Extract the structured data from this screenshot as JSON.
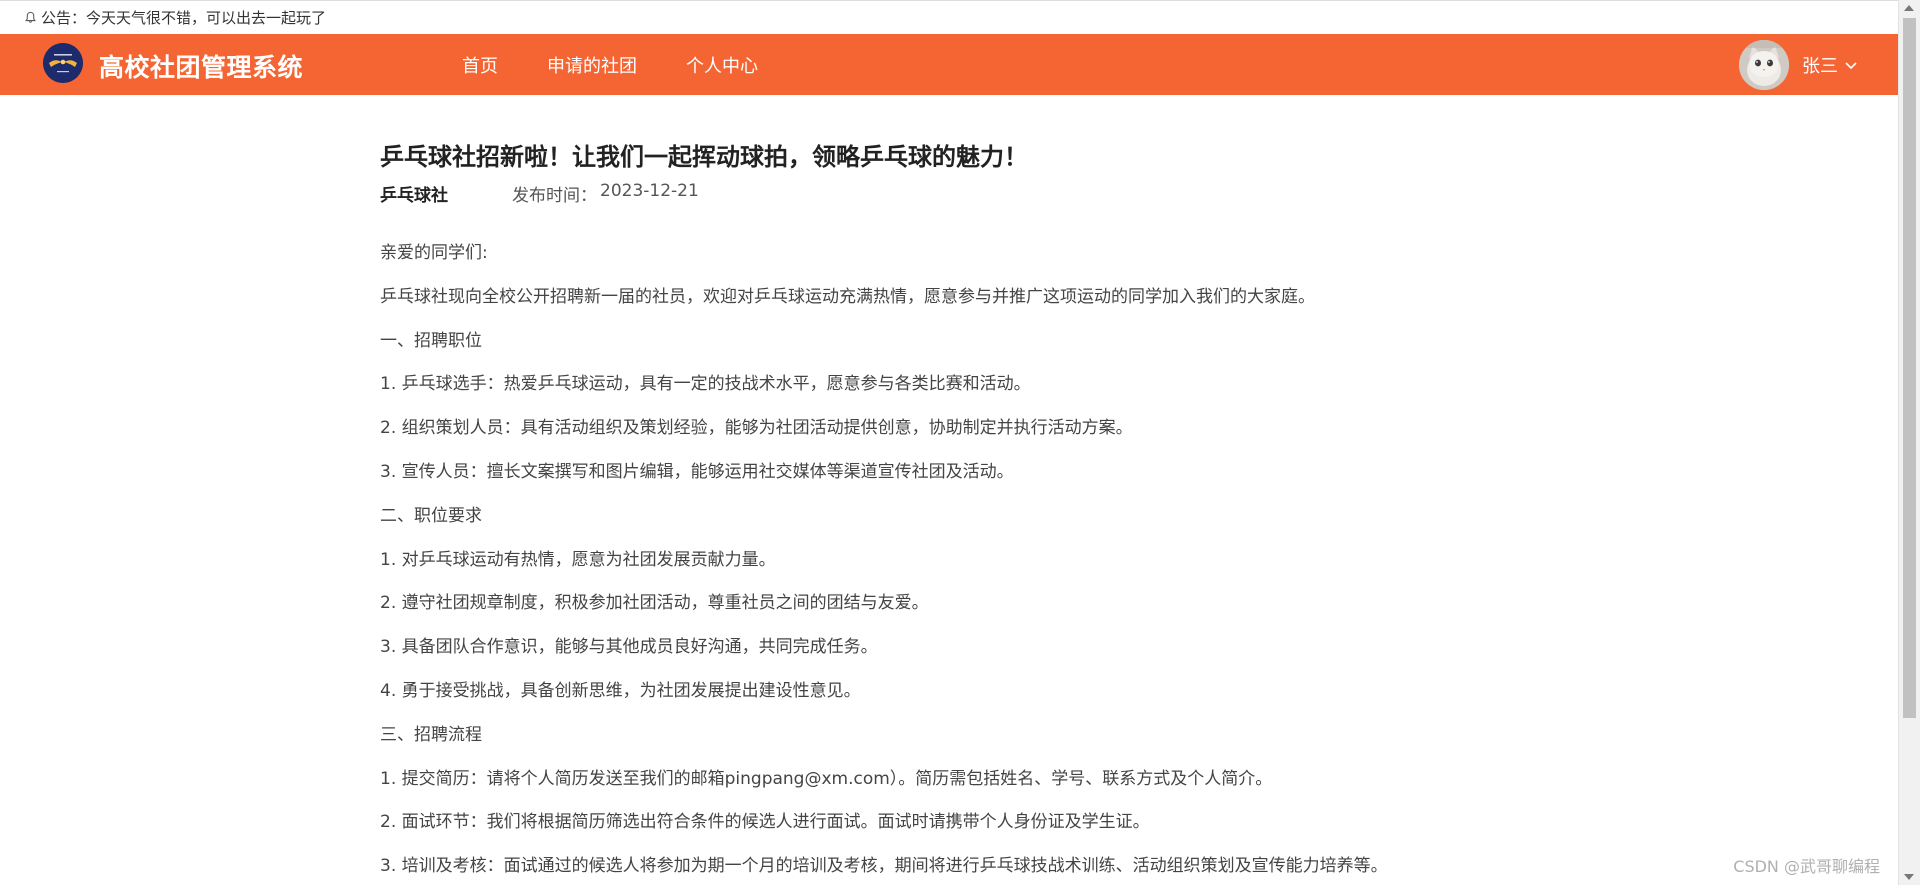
{
  "notice": {
    "icon": "bell-icon",
    "text": "公告：今天天气很不错，可以出去一起玩了"
  },
  "header": {
    "logo": "club-logo",
    "site_title": "高校社团管理系统",
    "nav": [
      {
        "label": "首页"
      },
      {
        "label": "申请的社团"
      },
      {
        "label": "个人中心"
      }
    ],
    "user": {
      "name": "张三",
      "avatar": "cat-avatar",
      "dropdown_icon": "chevron-down-icon"
    },
    "brand_color": "#f56533"
  },
  "article": {
    "title": "乒乓球社招新啦！让我们一起挥动球拍，领略乒乓球的魅力！",
    "club": "乒乓球社",
    "publish_label": "发布时间：",
    "publish_date": "2023-12-21",
    "lines": [
      "亲爱的同学们:",
      "乒乓球社现向全校公开招聘新一届的社员，欢迎对乒乓球运动充满热情，愿意参与并推广这项运动的同学加入我们的大家庭。",
      "一、招聘职位",
      "1. 乒乓球选手：热爱乒乓球运动，具有一定的技战术水平，愿意参与各类比赛和活动。",
      "2. 组织策划人员：具有活动组织及策划经验，能够为社团活动提供创意，协助制定并执行活动方案。",
      "3. 宣传人员：擅长文案撰写和图片编辑，能够运用社交媒体等渠道宣传社团及活动。",
      "二、职位要求",
      "1. 对乒乓球运动有热情，愿意为社团发展贡献力量。",
      "2. 遵守社团规章制度，积极参加社团活动，尊重社员之间的团结与友爱。",
      "3. 具备团队合作意识，能够与其他成员良好沟通，共同完成任务。",
      "4. 勇于接受挑战，具备创新思维，为社团发展提出建设性意见。",
      "三、招聘流程",
      "1. 提交简历：请将个人简历发送至我们的邮箱pingpang@xm.com）。简历需包括姓名、学号、联系方式及个人简介。",
      "2. 面试环节：我们将根据简历筛选出符合条件的候选人进行面试。面试时请携带个人身份证及学生证。",
      "3. 培训及考核：面试通过的候选人将参加为期一个月的培训及考核，期间将进行乒乓球技战术训练、活动组织策划及宣传能力培养等。"
    ]
  },
  "watermark": "CSDN @武哥聊编程"
}
